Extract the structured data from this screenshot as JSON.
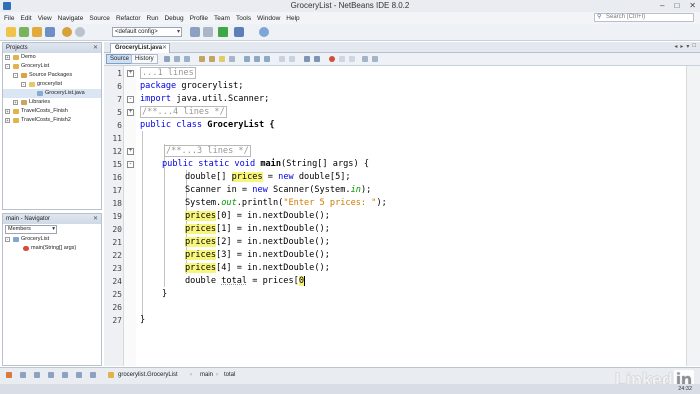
{
  "window": {
    "title": "GroceryList - NetBeans IDE 8.0.2",
    "min": "–",
    "max": "□",
    "close": "✕"
  },
  "menu": [
    "File",
    "Edit",
    "View",
    "Navigate",
    "Source",
    "Refactor",
    "Run",
    "Debug",
    "Profile",
    "Team",
    "Tools",
    "Window",
    "Help"
  ],
  "search": {
    "placeholder": "Search (Ctrl+I)"
  },
  "toolbar": {
    "config": "<default config>"
  },
  "projects": {
    "tab": "Projects",
    "items": [
      {
        "label": "Demo",
        "tog": "+"
      },
      {
        "label": "GroceryList",
        "tog": "-"
      },
      {
        "label": "Source Packages",
        "tog": "-"
      },
      {
        "label": "grocerylist",
        "tog": "-"
      },
      {
        "label": "GroceryList.java",
        "tog": ""
      },
      {
        "label": "Libraries",
        "tog": "+"
      },
      {
        "label": "TravelCosts_Finish",
        "tog": "+"
      },
      {
        "label": "TravelCosts_Finish2",
        "tog": "+"
      }
    ]
  },
  "navigator": {
    "tab": "main - Navigator",
    "filter": "Members",
    "items": [
      {
        "label": "GroceryList"
      },
      {
        "label": "main(String[] args)"
      }
    ]
  },
  "editor": {
    "tab": "GroceryList.java",
    "source_label": "Source",
    "history_label": "History",
    "line_numbers": [
      "1",
      "6",
      "7",
      "5",
      "6",
      "11",
      "12",
      "15",
      "16",
      "17",
      "18",
      "19",
      "20",
      "21",
      "22",
      "23",
      "24",
      "25",
      "26",
      "27"
    ],
    "fold_markers": [
      "+",
      "",
      "",
      "-",
      "+",
      "",
      "",
      "+",
      "-"
    ],
    "lines": {
      "l1": "...1 lines",
      "l2_kw": "package",
      "l2_rest": " grocerylist;",
      "l3_kw": "import",
      "l3_rest": " java.util.Scanner;",
      "l4": "/**...4 lines */",
      "l5_kw": "public class",
      "l5_rest": " GroceryList {",
      "l7": "/**...3 lines */",
      "l8_kw": "public static void",
      "l8_name": "main",
      "l8_rest": "(String[] args) {",
      "l9_a": "double[] ",
      "l9_var": "prices",
      "l9_b": " = ",
      "l9_kw": "new",
      "l9_c": " double[5];",
      "l10_a": "Scanner in = ",
      "l10_kw": "new",
      "l10_b": " Scanner(System.",
      "l10_fld": "in",
      "l10_c": ");",
      "l11_a": "System.",
      "l11_fld": "out",
      "l11_b": ".println(",
      "l11_str": "\"Enter 5 prices: \"",
      "l11_c": ");",
      "p_var": "prices",
      "p0": "[0] = in.nextDouble();",
      "p1": "[1] = in.nextDouble();",
      "p2": "[2] = in.nextDouble();",
      "p3": "[3] = in.nextDouble();",
      "p4": "[4] = in.nextDouble();",
      "l17_a": "double ",
      "l17_var": "total",
      "l17_b": " = prices[",
      "l17_c": "0",
      "close_method": "}",
      "close_class": "}"
    }
  },
  "breadcrumbs": [
    "grocerylist.GroceryList",
    "main",
    "total"
  ],
  "status": {
    "clock": "24:32"
  },
  "watermark": {
    "brand": "Linked",
    "in": "in"
  }
}
